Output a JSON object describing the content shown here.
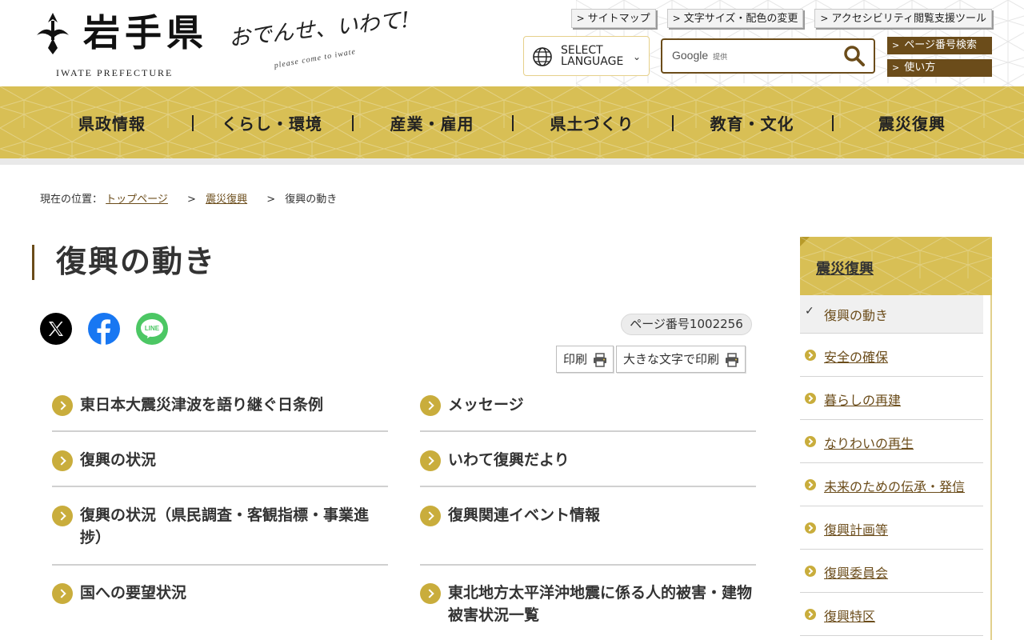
{
  "header": {
    "logo_text": "岩手県",
    "logo_sub": "IWATE PREFECTURE",
    "tagline": "おでんせ、いわて!",
    "tagline_sub": "please come to iwate",
    "top_links": [
      "サイトマップ",
      "文字サイズ・配色の変更",
      "アクセシビリティ閲覧支援ツール"
    ],
    "language_label": "SELECT LANGUAGE",
    "search_brand": "Google",
    "search_brand_sub": "提供",
    "page_number_search": "ページ番号検索",
    "how_to_use": "使い方"
  },
  "nav": {
    "items": [
      "県政情報",
      "くらし・環境",
      "産業・雇用",
      "県土づくり",
      "教育・文化",
      "震災復興"
    ]
  },
  "breadcrumb": {
    "prefix": "現在の位置：",
    "items": [
      "トップページ",
      "震災復興"
    ],
    "current": "復興の動き",
    "separator": ">"
  },
  "page": {
    "title": "復興の動き",
    "page_number": "ページ番号1002256",
    "print_label": "印刷",
    "print_large_label": "大きな文字で印刷"
  },
  "social": {
    "x_icon": "x-icon",
    "facebook_icon": "facebook-icon",
    "line_icon": "line-icon",
    "line_text": "LINE"
  },
  "links": [
    "東日本大震災津波を語り継ぐ日条例",
    "メッセージ",
    "復興の状況",
    "いわて復興だより",
    "復興の状況（県民調査・客観指標・事業進捗）",
    "復興関連イベント情報",
    "国への要望状況",
    "東北地方太平洋沖地震に係る人的被害・建物被害状況一覧"
  ],
  "sidebar": {
    "heading": "震災復興",
    "items": [
      "復興の動き",
      "安全の確保",
      "暮らしの再建",
      "なりわいの再生",
      "未来のための伝承・発信",
      "復興計画等",
      "復興委員会",
      "復興特区"
    ]
  },
  "colors": {
    "gold": "#d8bf55",
    "brown": "#6b4c1a",
    "arrow": "#c9ad3c"
  }
}
